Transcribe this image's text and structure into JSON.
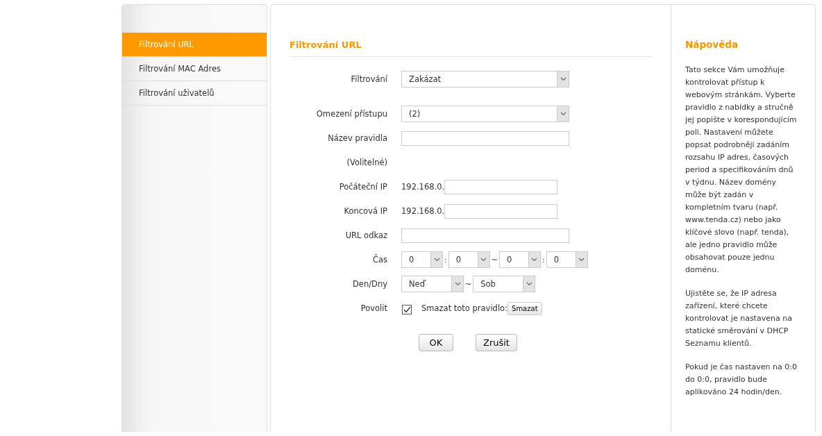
{
  "sidebar": {
    "items": [
      {
        "label": "Filtrování URL",
        "selected": true
      },
      {
        "label": "Filtrování MAC Adres",
        "selected": false
      },
      {
        "label": "Filtrování uživatelů",
        "selected": false
      }
    ]
  },
  "form": {
    "title": "Filtrování URL",
    "rows": [
      {
        "kind": "select",
        "label": "Filtrování",
        "value": "Zakázat"
      },
      {
        "kind": "select",
        "label": "Omezení přístupu",
        "value": "(2)"
      },
      {
        "kind": "text",
        "label": "Název pravidla",
        "note": "(Volitelné)"
      },
      {
        "kind": "ip",
        "label": "Počáteční IP",
        "prefix": "192.168.0."
      },
      {
        "kind": "ip",
        "label": "Koncová IP",
        "prefix": "192.168.0."
      },
      {
        "kind": "text",
        "label": "URL odkaz"
      },
      {
        "kind": "time",
        "label": "Čas",
        "parts": [
          {
            "value": "0"
          },
          {
            "sep": ":",
            "value": "0"
          },
          {
            "sep": "~",
            "value": "0"
          },
          {
            "sep": ":",
            "value": "0"
          }
        ]
      },
      {
        "kind": "days",
        "label": "Den/Dny",
        "parts": [
          {
            "value": "Neď"
          },
          {
            "sep": "~",
            "value": "Sob"
          }
        ]
      },
      {
        "kind": "checkbox",
        "label": "Povolit",
        "checked": true,
        "text": "Smazat toto pravidlo:",
        "button": "Smazat"
      }
    ],
    "buttons": [
      "OK",
      "Zrušit"
    ]
  },
  "help": {
    "title": "Nápověda",
    "paragraphs": [
      "Tato sekce Vám umožňuje kontrolovat přístup k webovým stránkám. Vyberte pravidlo z nabídky a stručně jej popište v korespondujícím poli. Nastavení můžete popsat podrobněji zadáním rozsahu IP adres, časových period a specifikováním dnů v týdnu. Název domény může být zadán v kompletním tvaru (např. www.tenda.cz) nebo jako klíčové slovo (např. tenda), ale jedno pravidlo může obsahovat pouze jednu doménu.",
      "Ujistěte se, že IP adresa zařízení, které chcete kontrolovat je nastavena na statické směrování v DHCP Seznamu klientů.",
      "Pokud je čas nastaven na 0:0 do 0:0, pravidlo bude aplikováno 24 hodin/den."
    ]
  }
}
